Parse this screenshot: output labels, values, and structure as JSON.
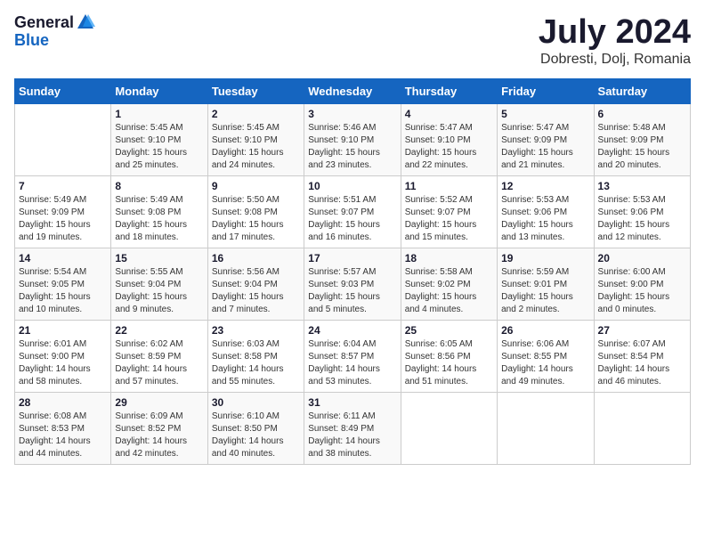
{
  "header": {
    "logo_general": "General",
    "logo_blue": "Blue",
    "month_title": "July 2024",
    "location": "Dobresti, Dolj, Romania"
  },
  "days_of_week": [
    "Sunday",
    "Monday",
    "Tuesday",
    "Wednesday",
    "Thursday",
    "Friday",
    "Saturday"
  ],
  "weeks": [
    [
      {
        "day": "",
        "info": ""
      },
      {
        "day": "1",
        "info": "Sunrise: 5:45 AM\nSunset: 9:10 PM\nDaylight: 15 hours\nand 25 minutes."
      },
      {
        "day": "2",
        "info": "Sunrise: 5:45 AM\nSunset: 9:10 PM\nDaylight: 15 hours\nand 24 minutes."
      },
      {
        "day": "3",
        "info": "Sunrise: 5:46 AM\nSunset: 9:10 PM\nDaylight: 15 hours\nand 23 minutes."
      },
      {
        "day": "4",
        "info": "Sunrise: 5:47 AM\nSunset: 9:10 PM\nDaylight: 15 hours\nand 22 minutes."
      },
      {
        "day": "5",
        "info": "Sunrise: 5:47 AM\nSunset: 9:09 PM\nDaylight: 15 hours\nand 21 minutes."
      },
      {
        "day": "6",
        "info": "Sunrise: 5:48 AM\nSunset: 9:09 PM\nDaylight: 15 hours\nand 20 minutes."
      }
    ],
    [
      {
        "day": "7",
        "info": "Sunrise: 5:49 AM\nSunset: 9:09 PM\nDaylight: 15 hours\nand 19 minutes."
      },
      {
        "day": "8",
        "info": "Sunrise: 5:49 AM\nSunset: 9:08 PM\nDaylight: 15 hours\nand 18 minutes."
      },
      {
        "day": "9",
        "info": "Sunrise: 5:50 AM\nSunset: 9:08 PM\nDaylight: 15 hours\nand 17 minutes."
      },
      {
        "day": "10",
        "info": "Sunrise: 5:51 AM\nSunset: 9:07 PM\nDaylight: 15 hours\nand 16 minutes."
      },
      {
        "day": "11",
        "info": "Sunrise: 5:52 AM\nSunset: 9:07 PM\nDaylight: 15 hours\nand 15 minutes."
      },
      {
        "day": "12",
        "info": "Sunrise: 5:53 AM\nSunset: 9:06 PM\nDaylight: 15 hours\nand 13 minutes."
      },
      {
        "day": "13",
        "info": "Sunrise: 5:53 AM\nSunset: 9:06 PM\nDaylight: 15 hours\nand 12 minutes."
      }
    ],
    [
      {
        "day": "14",
        "info": "Sunrise: 5:54 AM\nSunset: 9:05 PM\nDaylight: 15 hours\nand 10 minutes."
      },
      {
        "day": "15",
        "info": "Sunrise: 5:55 AM\nSunset: 9:04 PM\nDaylight: 15 hours\nand 9 minutes."
      },
      {
        "day": "16",
        "info": "Sunrise: 5:56 AM\nSunset: 9:04 PM\nDaylight: 15 hours\nand 7 minutes."
      },
      {
        "day": "17",
        "info": "Sunrise: 5:57 AM\nSunset: 9:03 PM\nDaylight: 15 hours\nand 5 minutes."
      },
      {
        "day": "18",
        "info": "Sunrise: 5:58 AM\nSunset: 9:02 PM\nDaylight: 15 hours\nand 4 minutes."
      },
      {
        "day": "19",
        "info": "Sunrise: 5:59 AM\nSunset: 9:01 PM\nDaylight: 15 hours\nand 2 minutes."
      },
      {
        "day": "20",
        "info": "Sunrise: 6:00 AM\nSunset: 9:00 PM\nDaylight: 15 hours\nand 0 minutes."
      }
    ],
    [
      {
        "day": "21",
        "info": "Sunrise: 6:01 AM\nSunset: 9:00 PM\nDaylight: 14 hours\nand 58 minutes."
      },
      {
        "day": "22",
        "info": "Sunrise: 6:02 AM\nSunset: 8:59 PM\nDaylight: 14 hours\nand 57 minutes."
      },
      {
        "day": "23",
        "info": "Sunrise: 6:03 AM\nSunset: 8:58 PM\nDaylight: 14 hours\nand 55 minutes."
      },
      {
        "day": "24",
        "info": "Sunrise: 6:04 AM\nSunset: 8:57 PM\nDaylight: 14 hours\nand 53 minutes."
      },
      {
        "day": "25",
        "info": "Sunrise: 6:05 AM\nSunset: 8:56 PM\nDaylight: 14 hours\nand 51 minutes."
      },
      {
        "day": "26",
        "info": "Sunrise: 6:06 AM\nSunset: 8:55 PM\nDaylight: 14 hours\nand 49 minutes."
      },
      {
        "day": "27",
        "info": "Sunrise: 6:07 AM\nSunset: 8:54 PM\nDaylight: 14 hours\nand 46 minutes."
      }
    ],
    [
      {
        "day": "28",
        "info": "Sunrise: 6:08 AM\nSunset: 8:53 PM\nDaylight: 14 hours\nand 44 minutes."
      },
      {
        "day": "29",
        "info": "Sunrise: 6:09 AM\nSunset: 8:52 PM\nDaylight: 14 hours\nand 42 minutes."
      },
      {
        "day": "30",
        "info": "Sunrise: 6:10 AM\nSunset: 8:50 PM\nDaylight: 14 hours\nand 40 minutes."
      },
      {
        "day": "31",
        "info": "Sunrise: 6:11 AM\nSunset: 8:49 PM\nDaylight: 14 hours\nand 38 minutes."
      },
      {
        "day": "",
        "info": ""
      },
      {
        "day": "",
        "info": ""
      },
      {
        "day": "",
        "info": ""
      }
    ]
  ]
}
